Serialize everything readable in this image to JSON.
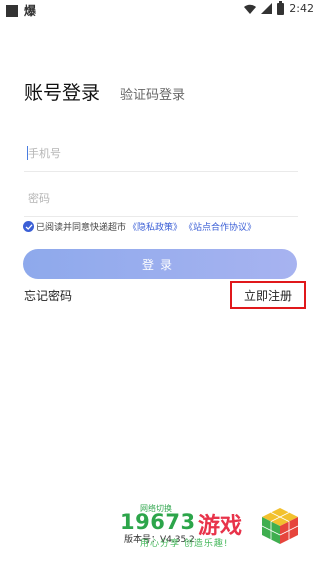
{
  "status_bar": {
    "app_label": "爆",
    "time": "2:42"
  },
  "tabs": {
    "account_login": "账号登录",
    "sms_login": "验证码登录"
  },
  "form": {
    "phone_placeholder": "手机号",
    "password_placeholder": "密码"
  },
  "agreement": {
    "text": "已阅读并同意快递超市",
    "privacy_policy": "《隐私政策》",
    "partner_agreement": "《站点合作协议》"
  },
  "buttons": {
    "login": "登录",
    "forgot_password": "忘记密码",
    "register": "立即注册"
  },
  "footer": {
    "network_switch": "网络切换",
    "version": "版本号：V4.35.2"
  },
  "watermark": {
    "number": "19673",
    "brand": "游戏",
    "slogan": "用心分享 创造乐趣!"
  },
  "colors": {
    "accent": "#3b5fd6",
    "login_button": "#8ea9ec",
    "register_highlight": "#e0181b",
    "watermark_green": "#2ca54a",
    "watermark_red": "#e8334a"
  },
  "icons": [
    "app-square-icon",
    "wifi-icon",
    "signal-icon",
    "battery-icon",
    "checkbox-checked-icon",
    "cube-logo-icon"
  ]
}
